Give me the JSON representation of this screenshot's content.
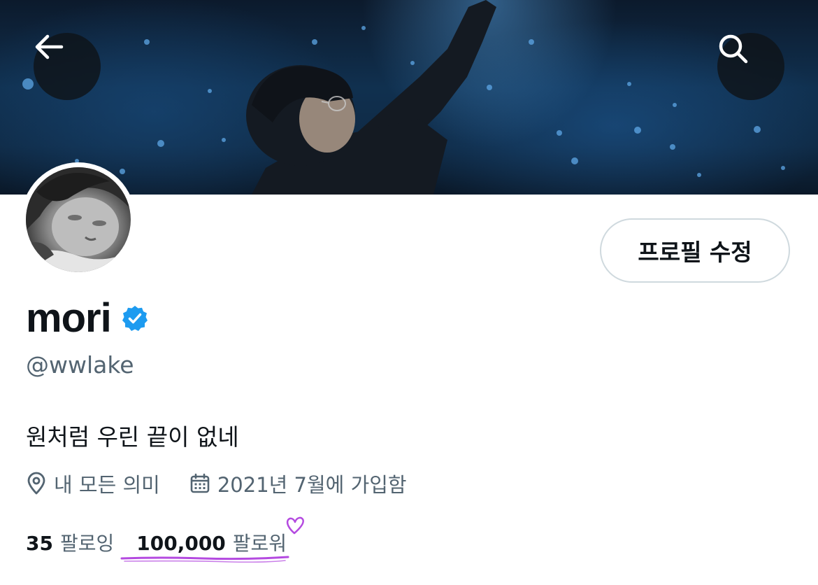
{
  "header": {
    "back_icon": "arrow-left-icon",
    "search_icon": "search-icon"
  },
  "profile": {
    "edit_button_label": "프로필 수정",
    "display_name": "mori",
    "verified_icon": "verified-badge-icon",
    "verified_color": "#1d9bf0",
    "handle": "@wwlake",
    "bio": "원처럼 우린 끝이 없네",
    "location": "내 모든 의미",
    "location_icon": "location-pin-icon",
    "joined": "2021년 7월에 가입함",
    "joined_icon": "calendar-icon",
    "following_count": "35",
    "following_label": "팔로잉",
    "followers_count": "100,000",
    "followers_label": "팔로워",
    "annotation_color": "#b44ae0"
  }
}
